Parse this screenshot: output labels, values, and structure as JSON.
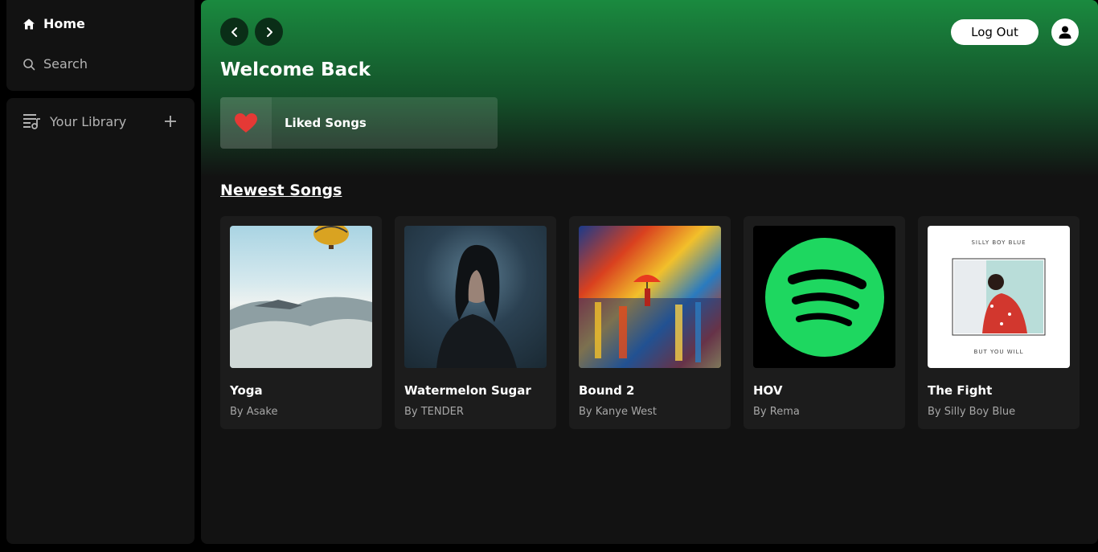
{
  "sidebar": {
    "nav": [
      {
        "label": "Home",
        "icon": "home-icon"
      },
      {
        "label": "Search",
        "icon": "search-icon"
      }
    ],
    "library": {
      "label": "Your Library",
      "icon": "library-icon",
      "add_icon": "plus-icon"
    }
  },
  "header": {
    "back_icon": "chevron-left-icon",
    "forward_icon": "chevron-right-icon",
    "logout_label": "Log Out",
    "avatar_icon": "user-icon"
  },
  "main": {
    "welcome": "Welcome Back",
    "liked_songs": {
      "label": "Liked Songs",
      "icon": "heart-icon",
      "icon_color": "#e53935"
    },
    "section_title": "Newest Songs",
    "songs": [
      {
        "title": "Yoga",
        "artist": "By Asake"
      },
      {
        "title": "Watermelon Sugar",
        "artist": "By TENDER"
      },
      {
        "title": "Bound 2",
        "artist": "By Kanye West"
      },
      {
        "title": "HOV",
        "artist": "By Rema"
      },
      {
        "title": "The Fight",
        "artist": "By Silly Boy Blue"
      }
    ],
    "album_text": {
      "fight_top": "SILLY BOY BLUE",
      "fight_bottom": "BUT YOU WILL"
    }
  },
  "colors": {
    "accent": "#1db954",
    "header_green": "#1a8a3f",
    "background": "#121212"
  }
}
